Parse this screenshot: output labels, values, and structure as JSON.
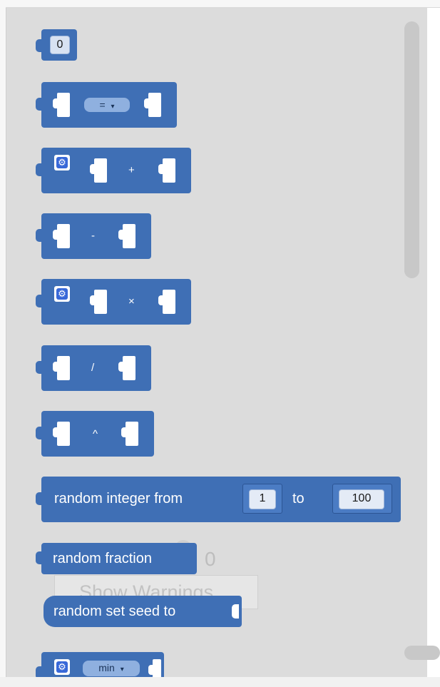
{
  "colors": {
    "block": "#3f6fb5",
    "flyout_bg": "#dcdcdc",
    "workspace_bg": "#ffffff"
  },
  "blocks": {
    "number": {
      "value": "0"
    },
    "compare": {
      "operator": "=",
      "dropdown_arrow": "▾"
    },
    "add": {
      "operator": "+",
      "mutator_icon": "gear-icon"
    },
    "subtract": {
      "operator": "-"
    },
    "multiply": {
      "operator": "×",
      "mutator_icon": "gear-icon"
    },
    "divide": {
      "operator": "/"
    },
    "power": {
      "operator": "^"
    },
    "random_integer": {
      "label": "random integer from",
      "from_value": "1",
      "to_label": "to",
      "to_value": "100"
    },
    "random_fraction": {
      "label": "random fraction"
    },
    "random_set_seed": {
      "label": "random set seed  to"
    },
    "min": {
      "dropdown_value": "min",
      "dropdown_arrow": "▾",
      "mutator_icon": "gear-icon"
    }
  },
  "background": {
    "warning_count": "0",
    "show_warnings_label": "Show Warnings"
  }
}
